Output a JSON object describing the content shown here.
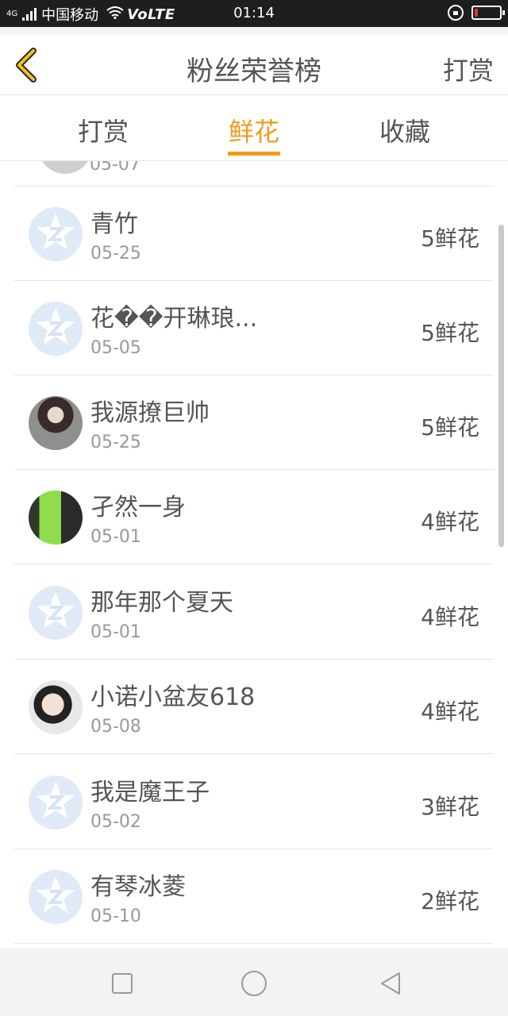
{
  "status_bar": {
    "signal_type": "4G",
    "carrier": "中国移动",
    "network_badge": "VoLTE",
    "time": "01:14",
    "battery_level": 0.12,
    "battery_color": "#e33333"
  },
  "header": {
    "back_icon": "chevron-left-icon",
    "title": "粉丝荣誉榜",
    "action_label": "打赏"
  },
  "tabs": [
    {
      "label": "打赏",
      "active": false
    },
    {
      "label": "鲜花",
      "active": true
    },
    {
      "label": "收藏",
      "active": false
    }
  ],
  "accent_color": "#f29b1a",
  "list": {
    "partial_top_date": "05-07",
    "rows": [
      {
        "name": "青竹",
        "date": "05-25",
        "count": "5鲜花",
        "avatar": "default-avatar-icon"
      },
      {
        "name": "花��开琳琅...",
        "date": "05-05",
        "count": "5鲜花",
        "avatar": "default-avatar-icon"
      },
      {
        "name": "我源撩巨帅",
        "date": "05-25",
        "count": "5鲜花",
        "avatar": "user-photo"
      },
      {
        "name": "孑然一身",
        "date": "05-01",
        "count": "4鲜花",
        "avatar": "user-photo"
      },
      {
        "name": "那年那个夏天",
        "date": "05-01",
        "count": "4鲜花",
        "avatar": "default-avatar-icon"
      },
      {
        "name": "小诺小盆友618",
        "date": "05-08",
        "count": "4鲜花",
        "avatar": "user-photo"
      },
      {
        "name": "我是魔王子",
        "date": "05-02",
        "count": "3鲜花",
        "avatar": "default-avatar-icon"
      },
      {
        "name": "有琴冰菱",
        "date": "05-10",
        "count": "2鲜花",
        "avatar": "default-avatar-icon"
      }
    ]
  },
  "nav_bar": {
    "recents_icon": "square-recents-icon",
    "home_icon": "circle-home-icon",
    "back_icon": "triangle-back-icon"
  }
}
